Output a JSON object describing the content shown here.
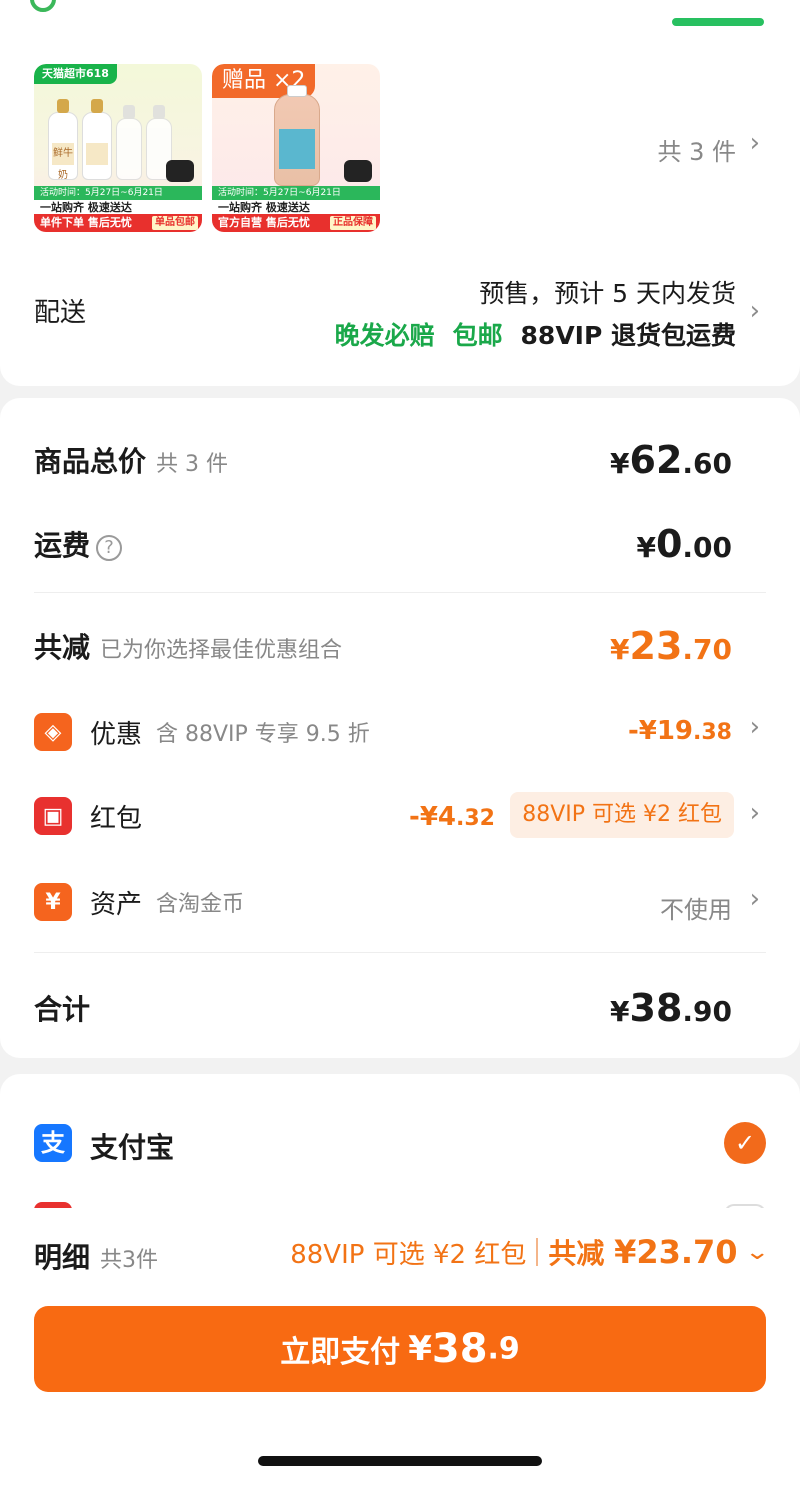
{
  "order": {
    "items": [
      {
        "image_name": "milk-pack-thumbnail",
        "top_badge": "天猫超市618",
        "bottle_label": "鲜牛奶",
        "stripe": "活动时间：5月27日~6月21日",
        "mid_strip": "一站购齐 极速送达",
        "bottom_strip": "单件下单 售后无忧",
        "bottom_tag": "单品包邮"
      },
      {
        "image_name": "gift-drink-thumbnail",
        "gift_badge": "赠品 ×2",
        "stripe": "活动时间：5月27日~6月21日",
        "mid_strip": "一站购齐 极速送达",
        "bottom_strip": "官方自营 售后无忧",
        "bottom_tag": "正品保障"
      }
    ],
    "count_label": "共 3 件",
    "delivery": {
      "label": "配送",
      "line1": "预售，预计 5 天内发货",
      "late_comp": "晚发必赔",
      "free_ship": "包邮",
      "vip_return": "88VIP 退货包运费"
    }
  },
  "price": {
    "total": {
      "label": "商品总价",
      "sub": "共 3 件",
      "yen": "¥",
      "int": "62",
      "dec": ".60"
    },
    "shipping": {
      "label": "运费",
      "help": "?",
      "yen": "¥",
      "int": "0",
      "dec": ".00"
    },
    "discount": {
      "label": "共减",
      "sub": "已为你选择最佳优惠组合",
      "yen": "¥",
      "int": "23",
      "dec": ".70"
    },
    "coupon": {
      "label": "优惠",
      "note": "含 88VIP 专享 9.5 折",
      "prefix": "-¥",
      "int": "19",
      "dec": ".38"
    },
    "redpack": {
      "label": "红包",
      "prefix": "-¥",
      "int": "4",
      "dec": ".32",
      "pill": "88VIP 可选 ¥2 红包"
    },
    "assets": {
      "label": "资产",
      "note": "含淘金币",
      "state": "不使用"
    },
    "sum": {
      "label": "合计",
      "yen": "¥",
      "int": "38",
      "dec": ".90"
    }
  },
  "payment": {
    "method": "支付宝",
    "selected": true
  },
  "footer": {
    "detail_label": "明细",
    "detail_count": "共3件",
    "promo": "88VIP 可选 ¥2 红包",
    "saved_label": "共减 ",
    "saved_value": "¥23.70",
    "pay_label": "立即支付",
    "pay_yen": "¥",
    "pay_int": "38",
    "pay_dec": ".9"
  },
  "colors": {
    "accent_orange": "#f27315",
    "button_orange": "#f86a12",
    "green": "#1aa84a",
    "alipay_blue": "#1677ff"
  }
}
